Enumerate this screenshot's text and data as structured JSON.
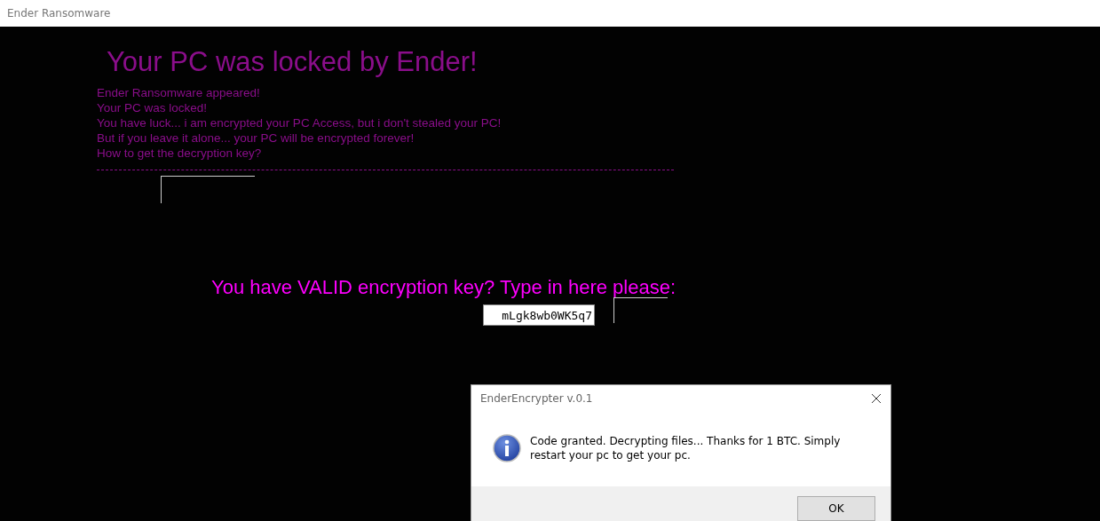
{
  "window": {
    "title": "Ender Ransomware"
  },
  "heading": "Your PC was locked by Ender!",
  "message_lines": [
    "Ender Ransomware appeared!",
    "Your PC was locked!",
    "You have luck... i am encrypted your PC Access, but i don't stealed your PC!",
    "But if you leave it alone... your PC will be encrypted forever!",
    "How to get the decryption key?"
  ],
  "prompt": "You have VALID encryption key? Type in here please:",
  "key_field": {
    "value": "mLgk8wb0WK5q7"
  },
  "dialog": {
    "title": "EnderEncrypter v.0.1",
    "message": "Code granted.  Decrypting files... Thanks for 1 BTC. Simply restart your pc to get your pc.",
    "button": "OK"
  }
}
